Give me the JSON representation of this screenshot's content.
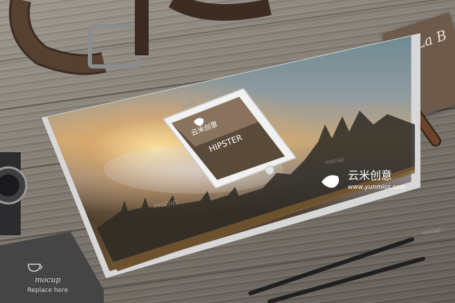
{
  "phone_screen": {
    "brand_cn": "云米创意",
    "headline": "HIPSTER"
  },
  "laptop_logo": {
    "brand_cn": "云米创意",
    "url": "www.yunmiss.com"
  },
  "watermark": {
    "text": "mocup"
  },
  "card": {
    "brand": "mocup",
    "tagline": "Replace here"
  },
  "sign": {
    "text": "La B"
  },
  "colors": {
    "wood": "#7c766d",
    "laptop_silver": "#d7d7d7",
    "belt": "#3a2a22",
    "cigar": "#5b3a23",
    "pencil": "#1f1f22"
  }
}
